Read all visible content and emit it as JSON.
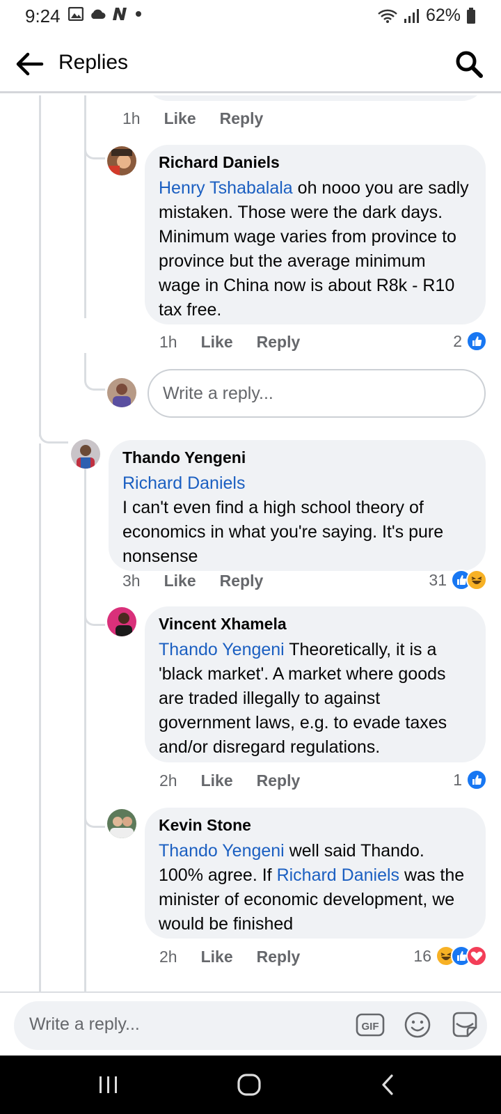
{
  "status": {
    "time": "9:24",
    "battery": "62%"
  },
  "header": {
    "title": "Replies"
  },
  "comments": [
    {
      "age": "1h",
      "like": "Like",
      "reply": "Reply"
    },
    {
      "name": "Richard Daniels",
      "mention": "Henry Tshabalala",
      "text": " oh nooo you are sadly mistaken. Those were the dark days. Minimum wage varies from province to province but the average minimum wage in China now is about R8k - R10 tax free.",
      "age": "1h",
      "like": "Like",
      "reply": "Reply",
      "reaction_count": "2"
    },
    {
      "name": "Thando Yengeni",
      "mention": "Richard Daniels",
      "text": "I can't even find a high school theory of economics in what you're saying. It's pure nonsense",
      "age": "3h",
      "like": "Like",
      "reply": "Reply",
      "reaction_count": "31"
    },
    {
      "name": "Vincent Xhamela",
      "mention": "Thando Yengeni",
      "text": " Theoretically, it is a 'black market'. A market where goods are traded illegally to against government laws, e.g. to evade taxes and/or disregard regulations.",
      "age": "2h",
      "like": "Like",
      "reply": "Reply",
      "reaction_count": "1"
    },
    {
      "name": "Kevin Stone",
      "mention": "Thando Yengeni",
      "text_a": " well said Thando. 100% agree. If ",
      "mention_b": "Richard Daniels",
      "text_b": " was the minister of economic development,  we would be finished",
      "age": "2h",
      "like": "Like",
      "reply": "Reply",
      "reaction_count": "16"
    }
  ],
  "inline_reply": {
    "placeholder": "Write a reply..."
  },
  "composer": {
    "placeholder": "Write a reply...",
    "gif_label": "GIF"
  },
  "colors": {
    "accent": "#1877f2",
    "mention": "#1b5fc1",
    "like": "#1877f2",
    "haha": "#f7b125",
    "love": "#f33e58"
  }
}
